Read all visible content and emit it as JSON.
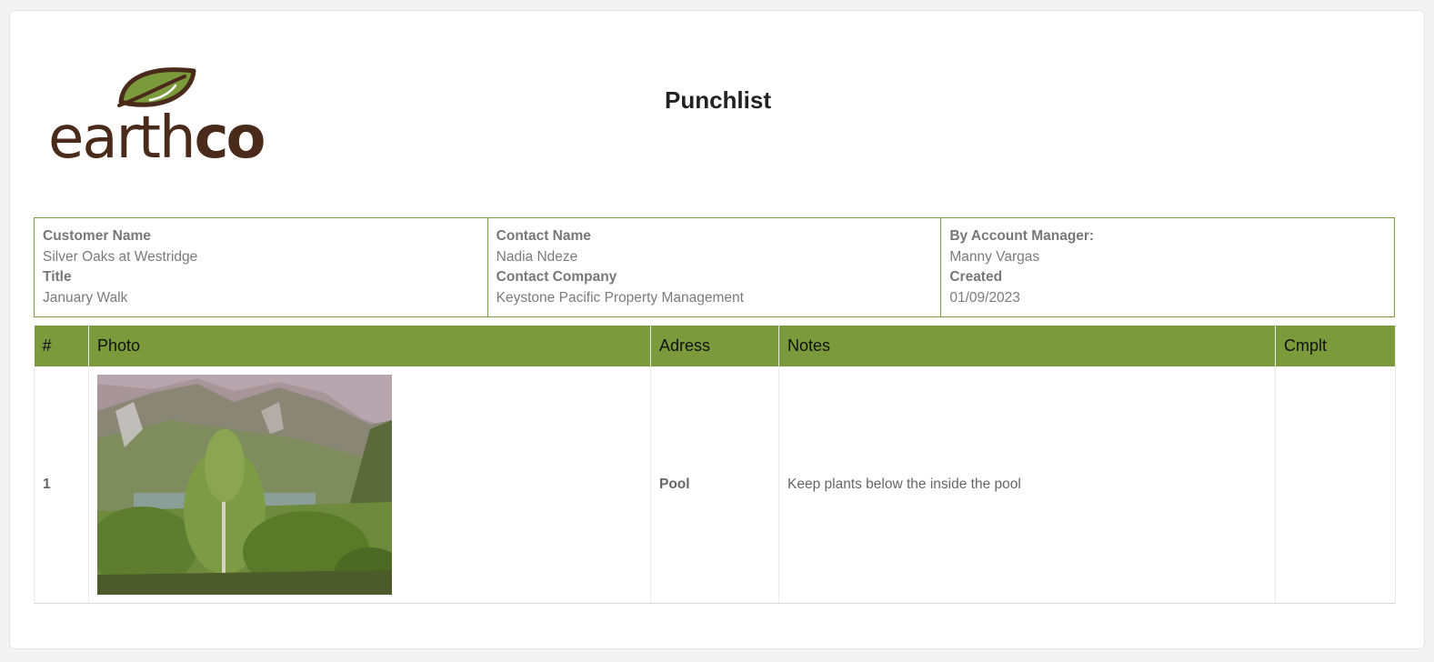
{
  "document": {
    "title": "Punchlist",
    "logo_text": "earthco"
  },
  "info": {
    "col1": {
      "customer_label": "Customer Name",
      "customer_value": "Silver Oaks at Westridge",
      "title_label": "Title",
      "title_value": "January Walk"
    },
    "col2": {
      "contact_label": "Contact Name",
      "contact_value": "Nadia Ndeze",
      "company_label": "Contact Company",
      "company_value": "Keystone Pacific Property Management"
    },
    "col3": {
      "manager_label": "By Account Manager:",
      "manager_value": "Manny Vargas",
      "created_label": "Created",
      "created_value": "01/09/2023"
    }
  },
  "table": {
    "headers": [
      "#",
      "Photo",
      "Adress",
      "Notes",
      "Cmplt"
    ],
    "rows": [
      {
        "num": "1",
        "photo_icon": "landscape-photo",
        "address": "Pool",
        "notes": "Keep plants below the inside the pool",
        "complete": ""
      }
    ]
  },
  "colors": {
    "accent": "#7a9a3c",
    "logo_brown": "#4a2a1a",
    "leaf_green": "#7a9a3c"
  }
}
